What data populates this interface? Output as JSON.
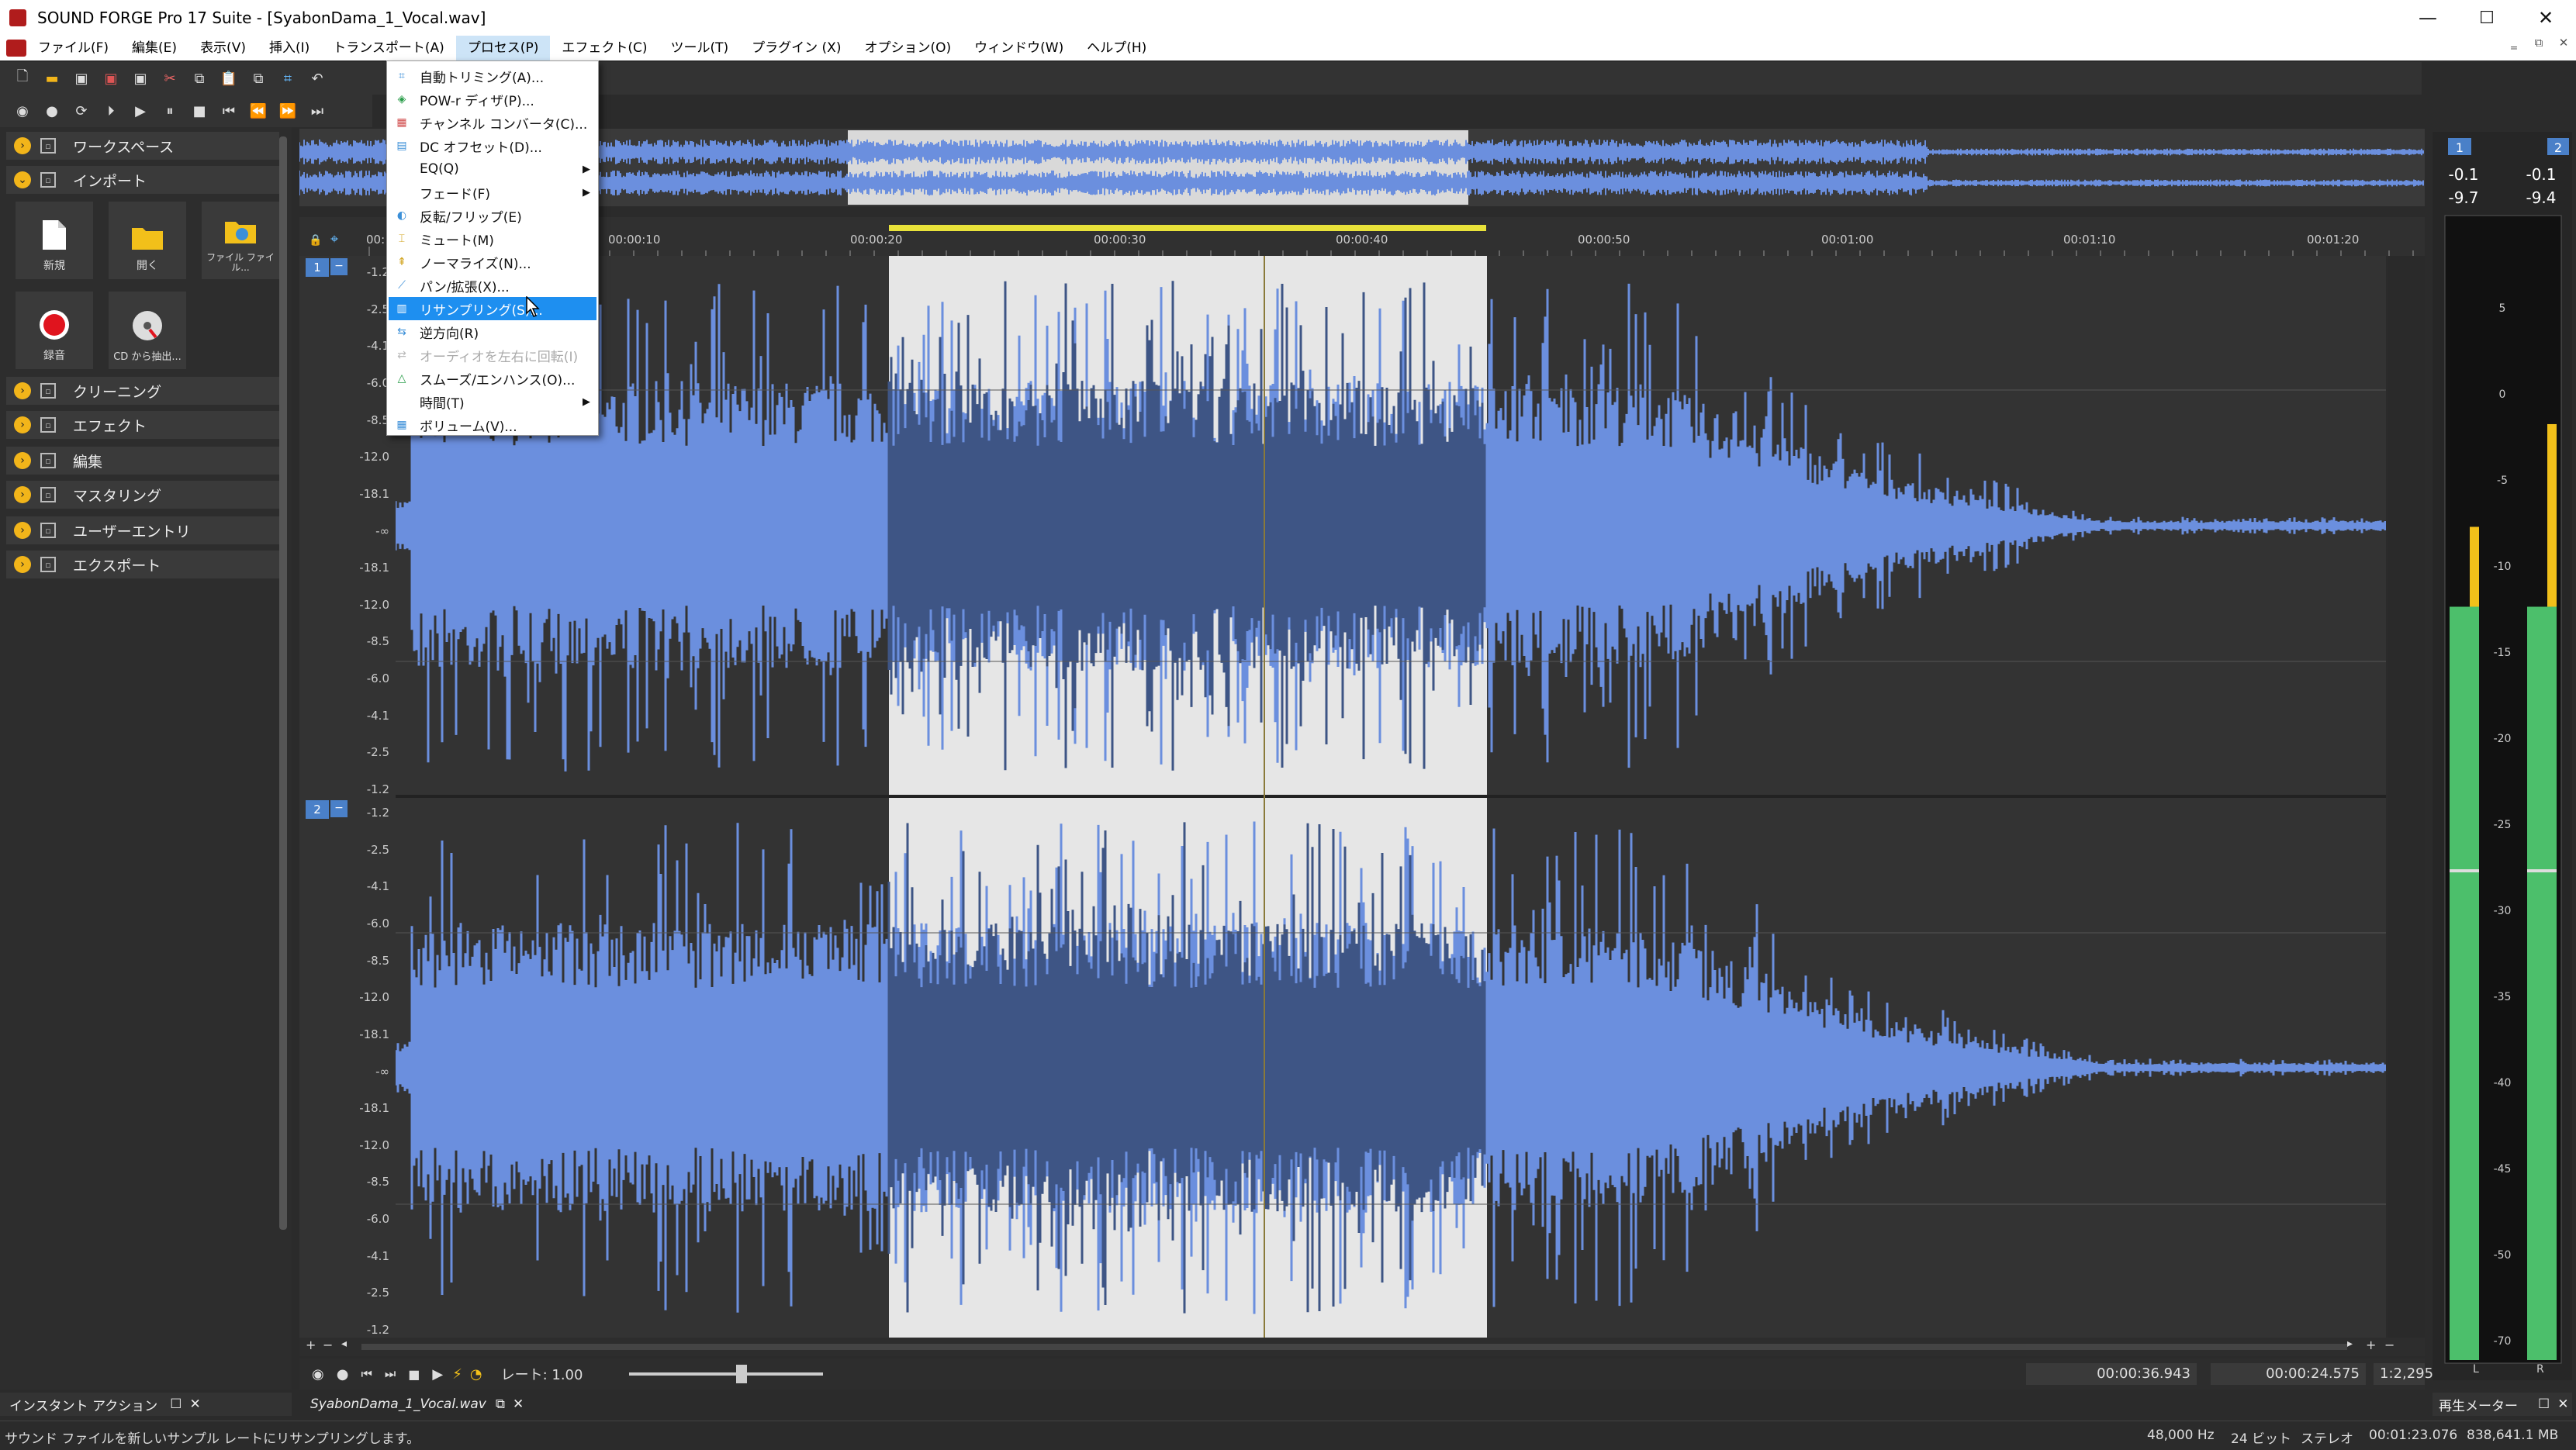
{
  "window": {
    "title": "SOUND FORGE Pro 17 Suite - [SyabonDama_1_Vocal.wav]",
    "min": "—",
    "max": "☐",
    "close": "✕"
  },
  "menubar": {
    "items": [
      "ファイル(F)",
      "編集(E)",
      "表示(V)",
      "挿入(I)",
      "トランスポート(A)",
      "プロセス(P)",
      "エフェクト(C)",
      "ツール(T)",
      "プラグイン (X)",
      "オプション(O)",
      "ウィンドウ(W)",
      "ヘルプ(H)"
    ],
    "active_index": 5,
    "mdi": [
      "‗",
      "⧉",
      "✕"
    ]
  },
  "process_menu": {
    "items": [
      {
        "label": "自動トリミング(A)...",
        "icon": "trim-icon",
        "submenu": false,
        "state": "normal"
      },
      {
        "label": "POW-r ディザ(P)...",
        "icon": "dither-icon",
        "submenu": false,
        "state": "normal"
      },
      {
        "label": "チャンネル コンバータ(C)...",
        "icon": "channel-icon",
        "submenu": false,
        "state": "normal"
      },
      {
        "label": "DC オフセット(D)...",
        "icon": "dc-icon",
        "submenu": false,
        "state": "normal"
      },
      {
        "label": "EQ(Q)",
        "icon": "",
        "submenu": true,
        "state": "normal"
      },
      {
        "label": "フェード(F)",
        "icon": "",
        "submenu": true,
        "state": "normal"
      },
      {
        "label": "反転/フリップ(E)",
        "icon": "flip-icon",
        "submenu": false,
        "state": "normal"
      },
      {
        "label": "ミュート(M)",
        "icon": "mute-icon",
        "submenu": false,
        "state": "normal"
      },
      {
        "label": "ノーマライズ(N)...",
        "icon": "normalize-icon",
        "submenu": false,
        "state": "normal"
      },
      {
        "label": "パン/拡張(X)...",
        "icon": "pan-icon",
        "submenu": false,
        "state": "normal"
      },
      {
        "label": "リサンプリング(S)...",
        "icon": "resample-icon",
        "submenu": false,
        "state": "highlighted"
      },
      {
        "label": "逆方向(R)",
        "icon": "reverse-icon",
        "submenu": false,
        "state": "normal"
      },
      {
        "label": "オーディオを左右に回転(I)",
        "icon": "swap-icon",
        "submenu": false,
        "state": "disabled"
      },
      {
        "label": "スムーズ/エンハンス(O)...",
        "icon": "smooth-icon",
        "submenu": false,
        "state": "normal"
      },
      {
        "label": "時間(T)",
        "icon": "",
        "submenu": true,
        "state": "normal"
      },
      {
        "label": "ボリューム(V)...",
        "icon": "volume-icon",
        "submenu": false,
        "state": "normal"
      }
    ]
  },
  "left_panel": {
    "sections": [
      {
        "label": "ワークスペース",
        "expanded": false
      },
      {
        "label": "インポート",
        "expanded": true
      },
      {
        "label": "クリーニング",
        "expanded": false
      },
      {
        "label": "エフェクト",
        "expanded": false
      },
      {
        "label": "編集",
        "expanded": false
      },
      {
        "label": "マスタリング",
        "expanded": false
      },
      {
        "label": "ユーザーエントリ",
        "expanded": false
      },
      {
        "label": "エクスポート",
        "expanded": false
      }
    ],
    "import_tiles": [
      "新規",
      "開く",
      "ファイル ファイル...",
      "録音",
      "CD から抽出..."
    ],
    "footer": "インスタント アクション"
  },
  "ruler": {
    "ticks": [
      "00:00:10",
      "00:00:20",
      "00:00:30",
      "00:00:40",
      "00:00:50",
      "00:01:00",
      "00:01:10",
      "00:01:20"
    ],
    "first": "00:"
  },
  "channels": [
    {
      "number": "1",
      "scale": [
        "-1.2",
        "-2.5",
        "-4.1",
        "-6.0",
        "-8.5",
        "-12.0",
        "-18.1",
        "-∞",
        "-18.1",
        "-12.0",
        "-8.5",
        "-6.0",
        "-4.1",
        "-2.5",
        "-1.2"
      ]
    },
    {
      "number": "2",
      "scale": [
        "-1.2",
        "-2.5",
        "-4.1",
        "-6.0",
        "-8.5",
        "-12.0",
        "-18.1",
        "-∞",
        "-18.1",
        "-12.0",
        "-8.5",
        "-6.0",
        "-4.1",
        "-2.5",
        "-1.2"
      ]
    }
  ],
  "transport": {
    "rate_label": "レート: 1.00",
    "cursor_time": "00:00:36.943",
    "selection_length": "00:00:24.575",
    "zoom": "1:2,295"
  },
  "document_tab": "SyabonDama_1_Vocal.wav",
  "meters": {
    "label": "再生メーター",
    "ch_labels": [
      "1",
      "2"
    ],
    "peak_left": "-0.1",
    "peak_right": "-0.1",
    "rms_left": "-9.7",
    "rms_right": "-9.4",
    "scale": [
      "5",
      "0",
      "-5",
      "-10",
      "-15",
      "-20",
      "-25",
      "-30",
      "-35",
      "-40",
      "-45",
      "-50",
      "-70"
    ],
    "bottom_labels": [
      "L",
      "R"
    ],
    "level_left": 0.73,
    "level_right": 0.82,
    "colors": {
      "green": "#4cbf6b",
      "yellow": "#f2c01a"
    }
  },
  "statusbar": {
    "message": "サウンド ファイルを新しいサンプル レートにリサンプリングします。",
    "sample_rate": "48,000 Hz",
    "bit_depth": "24 ビット",
    "channels": "ステレオ",
    "length": "00:01:23.076",
    "size": "838,641.1 MB"
  },
  "colors": {
    "wave": "#6b8fde",
    "wave_dark": "#3e5585",
    "selection": "#e6e6e6",
    "accent": "#1e8ff0"
  }
}
